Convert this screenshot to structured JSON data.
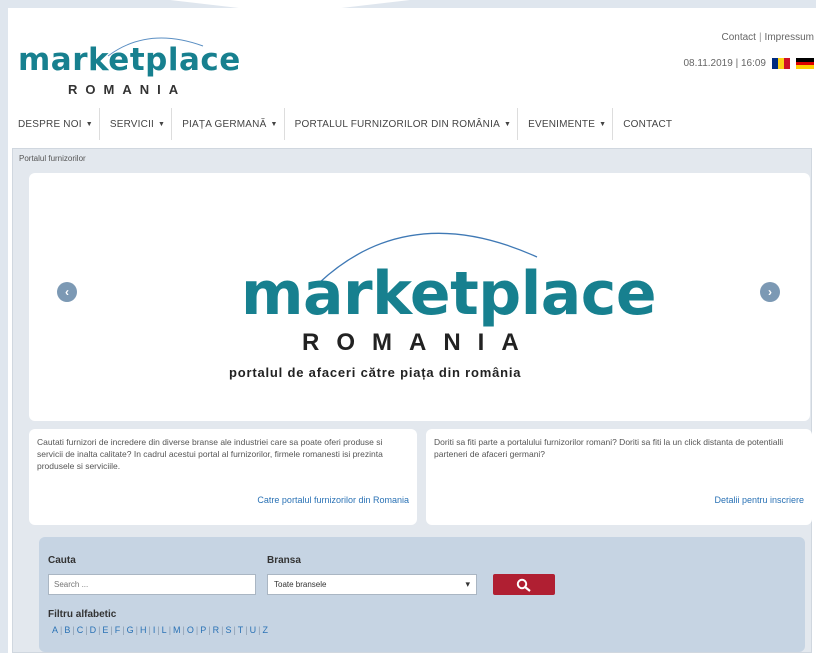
{
  "header": {
    "logo_word": "marketplace",
    "logo_sub": "ROMANIA",
    "top_links": [
      "Contact",
      "Impressum"
    ],
    "datetime": "08.11.2019 | 16:09"
  },
  "nav": {
    "items": [
      {
        "label": "DESPRE NOI",
        "dropdown": true
      },
      {
        "label": "SERVICII",
        "dropdown": true
      },
      {
        "label": "PIAȚA GERMANĂ",
        "dropdown": true
      },
      {
        "label": "PORTALUL FURNIZORILOR DIN ROMÂNIA",
        "dropdown": true
      },
      {
        "label": "EVENIMENTE",
        "dropdown": true
      },
      {
        "label": "CONTACT",
        "dropdown": false
      }
    ]
  },
  "breadcrumb": "Portalul furnizorilor",
  "banner": {
    "word": "marketplace",
    "sub": "ROMANIA",
    "tagline": "portalul de afaceri către piața din românia"
  },
  "info_left": {
    "text": "Cautati furnizori de incredere din diverse branse ale industriei care sa poate oferi produse si servicii de inalta calitate? In cadrul acestui portal al furnizorilor, firmele romanesti isi prezinta produsele si serviciile.",
    "link": "Catre portalul furnizorilor din Romania"
  },
  "info_right": {
    "text": "Doriti sa fiti parte a portalului furnizorilor romani? Doriti sa fiti la un click distanta de potentialli parteneri de afaceri germani?",
    "link": "Detalii pentru inscriere"
  },
  "search": {
    "search_label": "Cauta",
    "search_placeholder": "Search ...",
    "bransa_label": "Bransa",
    "bransa_selected": "Toate bransele",
    "filter_label": "Filtru alfabetic",
    "letters": [
      "A",
      "B",
      "C",
      "D",
      "E",
      "F",
      "G",
      "H",
      "I",
      "L",
      "M",
      "O",
      "P",
      "R",
      "S",
      "T",
      "U",
      "Z"
    ]
  },
  "colors": {
    "brand_teal": "#17808f",
    "search_button": "#b01f32",
    "link_blue": "#2a72b5"
  }
}
